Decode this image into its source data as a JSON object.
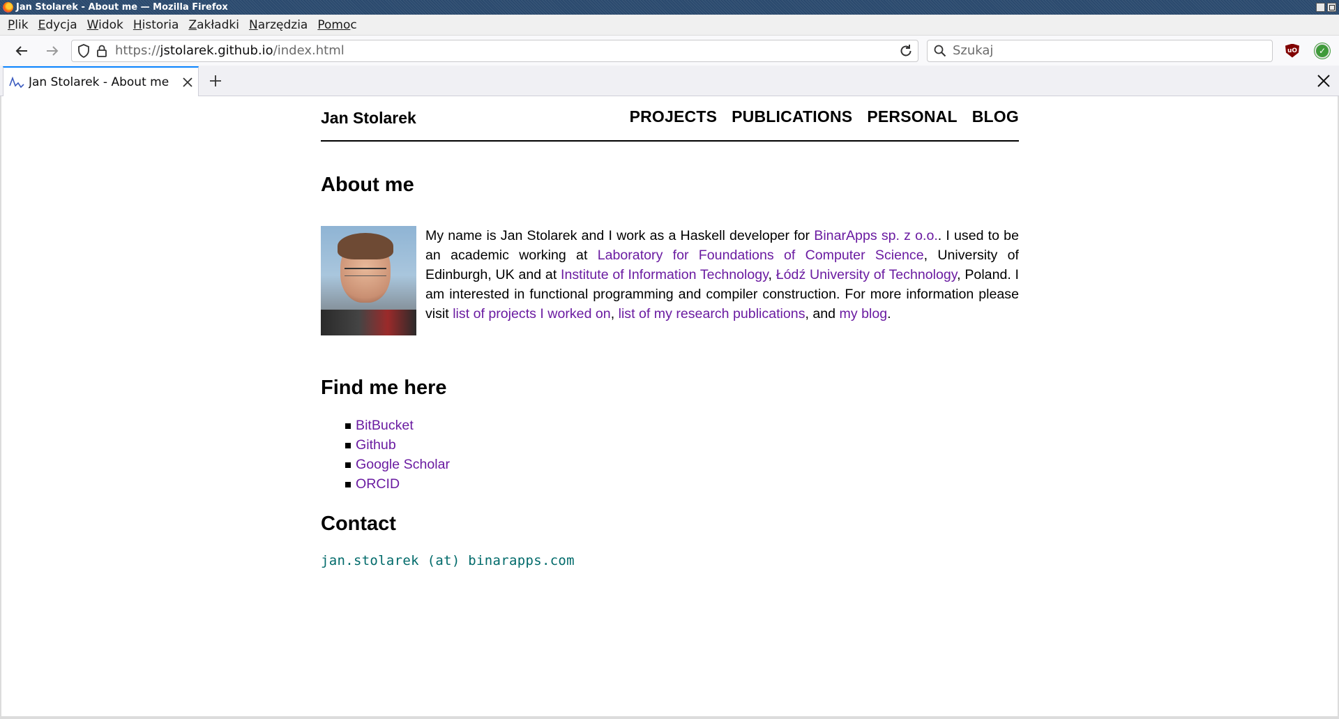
{
  "window": {
    "title": "Jan Stolarek - About me — Mozilla Firefox"
  },
  "menubar": {
    "items": [
      {
        "acc": "P",
        "rest": "lik"
      },
      {
        "acc": "E",
        "rest": "dycja"
      },
      {
        "acc": "W",
        "rest": "idok"
      },
      {
        "acc": "H",
        "rest": "istoria"
      },
      {
        "acc": "Z",
        "rest": "akładki"
      },
      {
        "acc": "N",
        "rest": "arzędzia"
      },
      {
        "acc": "Pomo",
        "rest": "c"
      }
    ]
  },
  "navbar": {
    "url_scheme": "https://",
    "url_host": "jstolarek.github.io",
    "url_path": "/index.html",
    "search_placeholder": "Szukaj"
  },
  "tabs": {
    "active_title": "Jan Stolarek - About me"
  },
  "site": {
    "title": "Jan Stolarek",
    "nav": [
      "PROJECTS",
      "PUBLICATIONS",
      "PERSONAL",
      "BLOG"
    ]
  },
  "about": {
    "heading": "About me",
    "t1": "My name is Jan Stolarek and I work as a Haskell developer for ",
    "l1": "BinarApps sp. z o.o.",
    "t2": ". I used to be an academic working at ",
    "l2": "Laboratory for Foundations of Computer Science",
    "t3": ", University of Edinburgh, UK and at ",
    "l3": "Institute of Information Technology",
    "t4": ", ",
    "l4": "Łódź University of Technology",
    "t5": ", Poland. I am interested in functional programming and compiler construction. For more information please visit ",
    "l5": "list of projects I worked on",
    "t6": ", ",
    "l6": "list of my research publications",
    "t7": ", and ",
    "l7": "my blog",
    "t8": "."
  },
  "find": {
    "heading": "Find me here",
    "links": [
      "BitBucket",
      "Github",
      "Google Scholar",
      "ORCID"
    ]
  },
  "contact": {
    "heading": "Contact",
    "email": "jan.stolarek (at) binarapps.com"
  },
  "colors": {
    "link": "#6a1ba1",
    "email": "#006a6a",
    "tab_accent": "#0a84ff"
  }
}
